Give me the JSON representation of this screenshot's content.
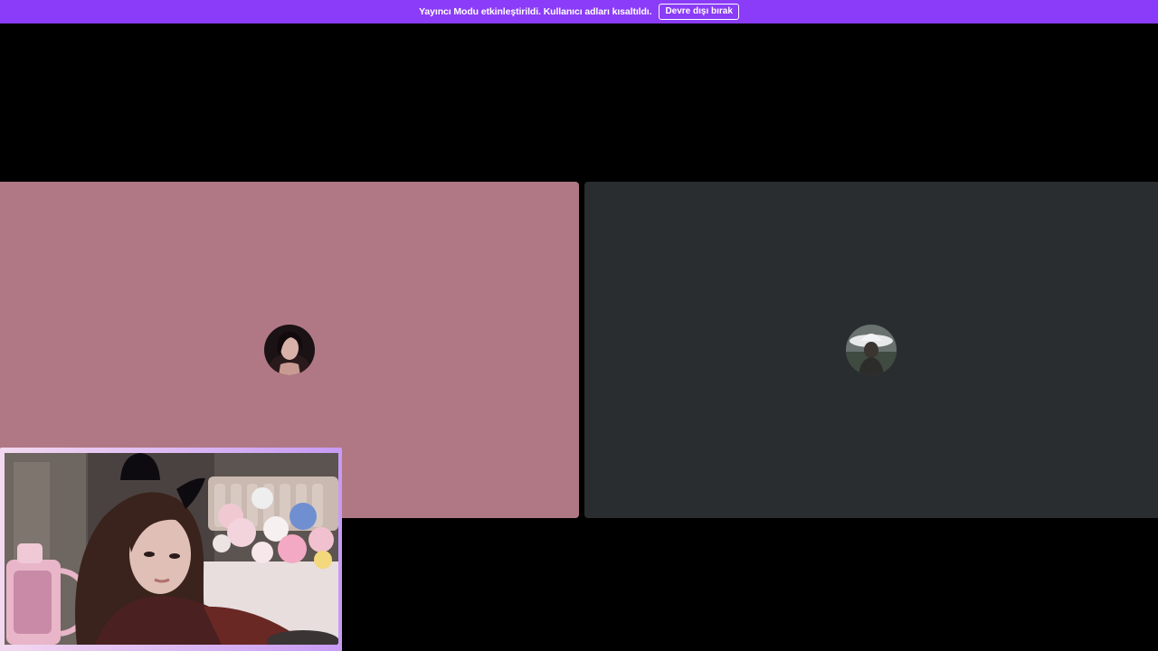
{
  "banner": {
    "message": "Yayıncı Modu etkinleştirildi. Kullanıcı adları kısaltıldı.",
    "disable_label": "Devre dışı bırak",
    "color": "#8a3cf8"
  },
  "stage": {
    "background": "#000000",
    "participants": [
      {
        "tile_color": "#b07884",
        "avatar": "participant-avatar-1"
      },
      {
        "tile_color": "#2a2d30",
        "avatar": "participant-avatar-2"
      }
    ]
  },
  "webcam": {
    "frame_colors": [
      "#f3d9f0",
      "#c79bf5"
    ]
  }
}
